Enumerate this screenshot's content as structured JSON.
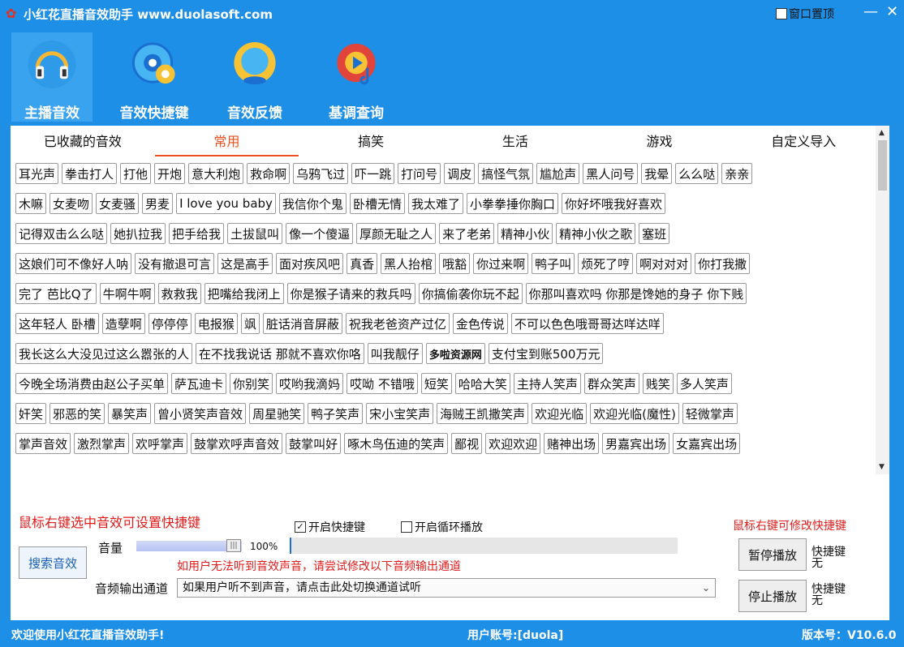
{
  "app": {
    "title": "小红花直播音效助手  www.duolasoft.com",
    "pin_label": "窗口置顶",
    "min_symbol": "—",
    "close_symbol": "✕"
  },
  "toolbar": {
    "items": [
      {
        "label": "主播音效",
        "icon": "headphones-icon",
        "active": true
      },
      {
        "label": "音效快捷键",
        "icon": "gear-hotkey-icon",
        "active": false
      },
      {
        "label": "音效反馈",
        "icon": "feedback-icon",
        "active": false
      },
      {
        "label": "基调查询",
        "icon": "music-search-icon",
        "active": false
      }
    ]
  },
  "tabs": [
    {
      "label": "已收藏的音效",
      "active": false
    },
    {
      "label": "常用",
      "active": true
    },
    {
      "label": "搞笑",
      "active": false
    },
    {
      "label": "生活",
      "active": false
    },
    {
      "label": "游戏",
      "active": false
    },
    {
      "label": "自定义导入",
      "active": false
    }
  ],
  "scroll": {
    "up": "▲",
    "down": "▼"
  },
  "sound_rows": [
    [
      "耳光声",
      "拳击打人",
      "打他",
      "开炮",
      "意大利炮",
      "救命啊",
      "乌鸦飞过",
      "吓一跳",
      "打问号",
      "调皮",
      "搞怪气氛",
      "尴尬声",
      "黑人问号",
      "我晕",
      "么么哒",
      "亲亲"
    ],
    [
      "木嘛",
      "女麦吻",
      "女麦骚",
      "男麦",
      "I love you baby",
      "我信你个鬼",
      "卧槽无情",
      "我太难了",
      "小拳拳捶你胸口",
      "你好坏哦我好喜欢"
    ],
    [
      "记得双击么么哒",
      "她扒拉我",
      "把手给我",
      "土拔鼠叫",
      "像一个傻逼",
      "厚颜无耻之人",
      "来了老弟",
      "精神小伙",
      "精神小伙之歌",
      "塞班"
    ],
    [
      "这娘们可不像好人呐",
      "没有撤退可言",
      "这是高手",
      "面对疾风吧",
      "真香",
      "黑人抬棺",
      "哦豁",
      "你过来啊",
      "鸭子叫",
      "烦死了哼",
      "啊对对对",
      "你打我撒"
    ],
    [
      "完了 芭比Q了",
      "牛啊牛啊",
      "救救我",
      "把嘴给我闭上",
      "你是猴子请来的救兵吗",
      "你搞偷袭你玩不起",
      "你那叫喜欢吗 你那是馋她的身子 你下贱"
    ],
    [
      "这年轻人 卧槽",
      "造孽啊",
      "停停停",
      "电报猴",
      "飒",
      "脏话消音屏蔽",
      "祝我老爸资产过亿",
      "金色传说",
      "不可以色色哦哥哥达咩达咩"
    ],
    [
      "我长这么大没见过这么嚣张的人",
      "在不找我说话 那就不喜欢你咯",
      "叫我靓仔",
      "多啦资源网",
      "支付宝到账500万元"
    ],
    [
      "今晚全场消费由赵公子买单",
      "萨瓦迪卡",
      "你别笑",
      "哎哟我滴妈",
      "哎呦 不错哦",
      "短笑",
      "哈哈大笑",
      "主持人笑声",
      "群众笑声",
      "贱笑",
      "多人笑声"
    ],
    [
      "奸笑",
      "邪恶的笑",
      "暴笑声",
      "曾小贤笑声音效",
      "周星驰笑",
      "鸭子笑声",
      "宋小宝笑声",
      "海贼王凯撒笑声",
      "欢迎光临",
      "欢迎光临(魔性)",
      "轻微掌声"
    ],
    [
      "掌声音效",
      "激烈掌声",
      "欢呼掌声",
      "鼓掌欢呼声音效",
      "鼓掌叫好",
      "啄木鸟伍迪的笑声",
      "鄙视",
      "欢迎欢迎",
      "赌神出场",
      "男嘉宾出场",
      "女嘉宾出场"
    ]
  ],
  "bottom": {
    "hint_left": "鼠标右键选中音效可设置快捷键",
    "enable_hotkey": {
      "label": "开启快捷键",
      "checked": true,
      "mark": "✓"
    },
    "loop_play": {
      "label": "开启循环播放",
      "checked": false,
      "mark": ""
    },
    "hint_right": "鼠标右键可修改快捷键",
    "search_label": "搜索音效",
    "volume_label": "音量",
    "volume_value": 1.0,
    "volume_text": "100%",
    "output_hint": "如用户无法听到音效声音，请尝试修改以下音频输出通道",
    "output_label": "音频输出通道",
    "output_selected": "如果用户听不到声音，请点击此处切换通道试听",
    "pause_label": "暂停播放",
    "stop_label": "停止播放",
    "hotkey_label": "快捷键",
    "hotkey_value": "无"
  },
  "status": {
    "welcome": "欢迎使用小红花直播音效助手!",
    "account": "用户账号:[duola]",
    "version": "版本号：V10.6.0"
  },
  "colors": {
    "accent": "#1d8fe6",
    "active_tab": "#e8501f",
    "warning": "#e21b1b"
  }
}
